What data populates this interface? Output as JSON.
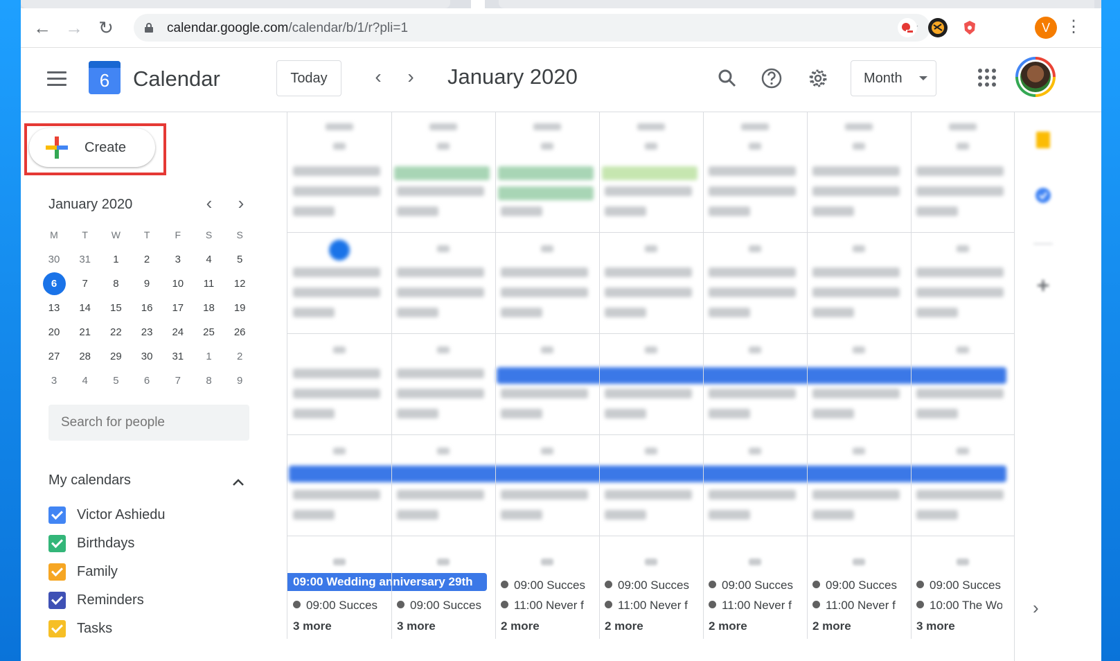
{
  "browser": {
    "url_host": "calendar.google.com",
    "url_path": "/calendar/b/1/r?pli=1",
    "profile_letter": "V"
  },
  "header": {
    "logo_day": "6",
    "app_title": "Calendar",
    "today_label": "Today",
    "date_title": "January 2020",
    "view_label": "Month"
  },
  "sidebar": {
    "create_label": "Create",
    "mini_title": "January 2020",
    "weekdays": [
      "M",
      "T",
      "W",
      "T",
      "F",
      "S",
      "S"
    ],
    "mini_weeks": [
      [
        "30",
        "31",
        "1",
        "2",
        "3",
        "4",
        "5"
      ],
      [
        "6",
        "7",
        "8",
        "9",
        "10",
        "11",
        "12"
      ],
      [
        "13",
        "14",
        "15",
        "16",
        "17",
        "18",
        "19"
      ],
      [
        "20",
        "21",
        "22",
        "23",
        "24",
        "25",
        "26"
      ],
      [
        "27",
        "28",
        "29",
        "30",
        "31",
        "1",
        "2"
      ],
      [
        "3",
        "4",
        "5",
        "6",
        "7",
        "8",
        "9"
      ]
    ],
    "selected_day": "6",
    "search_placeholder": "Search for people",
    "my_calendars_title": "My calendars",
    "calendars": [
      {
        "name": "Victor Ashiedu",
        "color": "#4285f4"
      },
      {
        "name": "Birthdays",
        "color": "#33b679"
      },
      {
        "name": "Family",
        "color": "#f6a623"
      },
      {
        "name": "Reminders",
        "color": "#3f51b5"
      },
      {
        "name": "Tasks",
        "color": "#f6bf26"
      }
    ]
  },
  "last_week": {
    "spanning_event": "09:00 Wedding anniversary 29th",
    "cells": [
      {
        "events": [
          "09:00 Succes"
        ],
        "more": "3 more"
      },
      {
        "events": [
          "09:00 Succes"
        ],
        "more": "3 more"
      },
      {
        "events": [
          "09:00 Succes",
          "11:00 Never f"
        ],
        "more": "2 more"
      },
      {
        "events": [
          "09:00 Succes",
          "11:00 Never f"
        ],
        "more": "2 more"
      },
      {
        "events": [
          "09:00 Succes",
          "11:00 Never f"
        ],
        "more": "2 more"
      },
      {
        "events": [
          "09:00 Succes",
          "11:00 Never f"
        ],
        "more": "2 more"
      },
      {
        "events": [
          "09:00 Succes",
          "10:00 The Wo"
        ],
        "more": "3 more"
      }
    ]
  },
  "colors": {
    "accent": "#1a73e8",
    "event_blue": "#3b78e7",
    "highlight_red": "#e53935"
  }
}
